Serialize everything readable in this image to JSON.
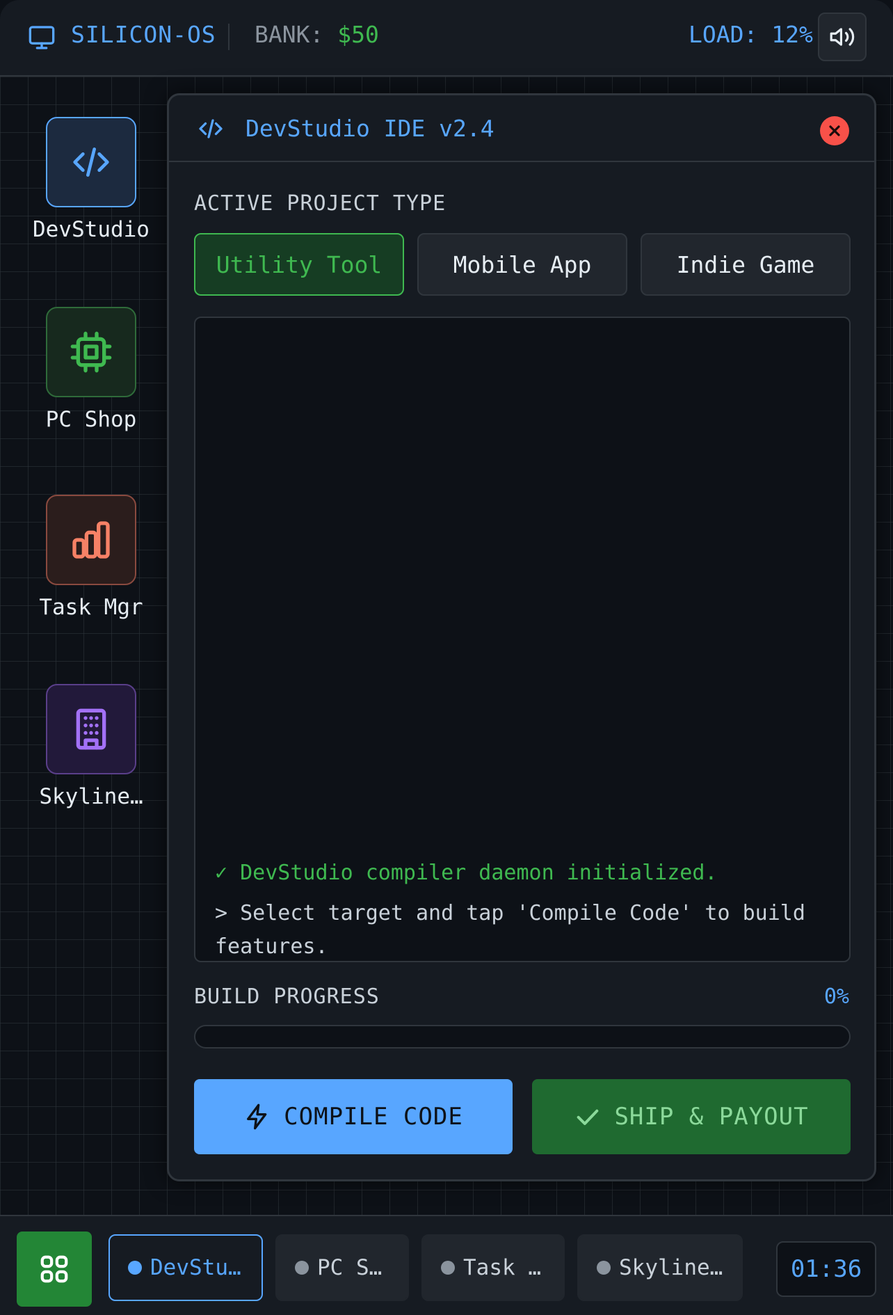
{
  "topbar": {
    "os_name": "SILICON-OS",
    "bank_label": "BANK:",
    "bank_value": "$50",
    "load_label": "LOAD:",
    "load_value": "12%",
    "icons": [
      "monitor-icon",
      "speaker-icon"
    ]
  },
  "desktop_icons": [
    {
      "label": "DevStudio",
      "icon": "code-icon",
      "color": "#58a6ff"
    },
    {
      "label": "PC Shop",
      "icon": "cpu-chip-icon",
      "color": "#3fb950"
    },
    {
      "label": "Task Mgr",
      "icon": "bar-chart-icon",
      "color": "#f78166"
    },
    {
      "label": "Skyline…",
      "icon": "building-icon",
      "color": "#a371f7"
    }
  ],
  "window": {
    "title": "DevStudio IDE v2.4",
    "section_label": "ACTIVE PROJECT TYPE",
    "project_types": [
      "Utility Tool",
      "Mobile App",
      "Indie Game"
    ],
    "selected_project_type": "Utility Tool",
    "console": {
      "line1": "✓ DevStudio compiler daemon initialized.",
      "line2": "> Select target and tap 'Compile Code' to build features."
    },
    "progress_label": "BUILD PROGRESS",
    "progress_text": "0%",
    "progress_value": 0,
    "compile_label": "COMPILE CODE",
    "ship_label": "SHIP & PAYOUT"
  },
  "taskbar": {
    "tasks": [
      {
        "label": "DevStu…",
        "active": true
      },
      {
        "label": "PC S…",
        "active": false
      },
      {
        "label": "Task …",
        "active": false
      },
      {
        "label": "Skyline…",
        "active": false
      }
    ],
    "clock": "01:36"
  },
  "colors": {
    "accent_blue": "#58a6ff",
    "accent_green": "#3fb950",
    "close_red": "#f85149",
    "background": "#0d1117"
  }
}
